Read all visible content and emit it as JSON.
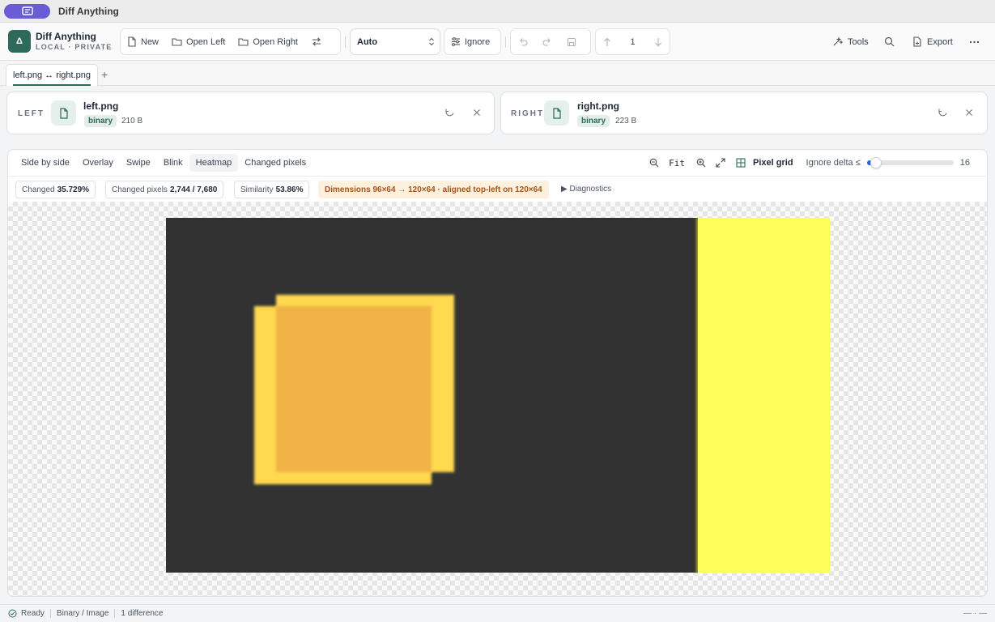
{
  "window": {
    "title": "Diff Anything"
  },
  "brand": {
    "logo_letter": "Δ",
    "name": "Diff Anything",
    "subtitle": "LOCAL · PRIVATE"
  },
  "toolbar": {
    "new_label": "New",
    "open_left_label": "Open Left",
    "open_right_label": "Open Right",
    "mode_select_value": "Auto",
    "ignore_label": "Ignore",
    "diff_index": "1",
    "tools_label": "Tools",
    "export_label": "Export"
  },
  "tabs": [
    {
      "label": "left.png ↔ right.png"
    }
  ],
  "left_file": {
    "side_label": "LEFT",
    "name": "left.png",
    "type_badge": "binary",
    "size": "210 B"
  },
  "right_file": {
    "side_label": "RIGHT",
    "name": "right.png",
    "type_badge": "binary",
    "size": "223 B"
  },
  "view_modes": [
    "Side by side",
    "Overlay",
    "Swipe",
    "Blink",
    "Heatmap",
    "Changed pixels"
  ],
  "active_view_mode": "Heatmap",
  "zoom": {
    "fit_label": "Fit",
    "pixel_grid_label": "Pixel grid",
    "ignore_delta_label": "Ignore delta ≤",
    "ignore_delta_value": "16",
    "ignore_delta_fraction": 0.06
  },
  "stats": {
    "changed_label": "Changed",
    "changed_value": "35.729%",
    "changed_pixels_label": "Changed pixels",
    "changed_pixels_value": "2,744 / 7,680",
    "similarity_label": "Similarity",
    "similarity_value": "53.86%",
    "dimensions_text": "Dimensions 96×64 → 120×64 · aligned top-left on 120×64",
    "diagnostics_label": "▶ Diagnostics"
  },
  "status": {
    "state": "Ready",
    "file_kind": "Binary / Image",
    "differences": "1 difference",
    "right_glyph": "— · —"
  },
  "colors": {
    "accent": "#2d6a5a",
    "image_bg": "#323232",
    "strip": "#ffff5a",
    "square_light": "#ffd94f",
    "square_orange": "#f1b246",
    "warn_bg": "#fdf0dc",
    "warn_text": "#a5541b"
  }
}
